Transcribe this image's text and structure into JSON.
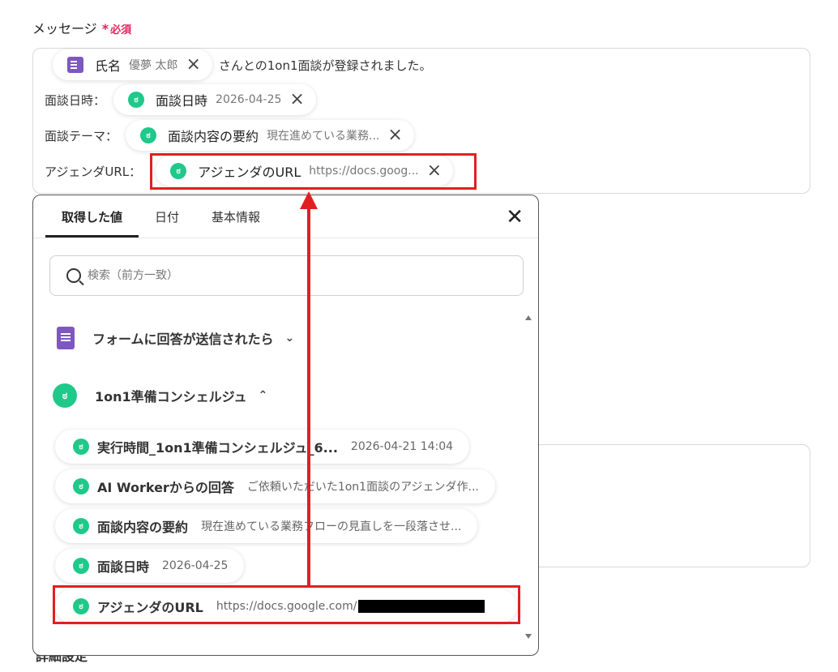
{
  "field": {
    "label": "メッセージ",
    "required": "必須",
    "required_mark": "*"
  },
  "message": {
    "line1": {
      "chip": {
        "name": "氏名",
        "value": "優夢 太郎"
      },
      "suffix": "さんとの1on1面談が登録されました。"
    },
    "line2": {
      "prefix": "面談日時：",
      "chip": {
        "name": "面談日時",
        "value": "2026-04-25"
      }
    },
    "line3": {
      "prefix": "面談テーマ：",
      "chip": {
        "name": "面談内容の要約",
        "value": "現在進めている業務..."
      }
    },
    "line4": {
      "prefix": "アジェンダURL：",
      "chip": {
        "name": "アジェンダのURL",
        "value": "https://docs.goog..."
      }
    },
    "remove_icon": "×"
  },
  "background": {
    "bottom_text": "詳細設定"
  },
  "panel": {
    "tabs": [
      {
        "label": "取得した値",
        "active": true
      },
      {
        "label": "日付"
      },
      {
        "label": "基本情報"
      }
    ],
    "close_icon": "✕",
    "search": {
      "placeholder": "検索（前方一致）"
    },
    "sections": [
      {
        "title": "フォームに回答が送信されたら",
        "chevron": "⌄",
        "icon": "form-icon"
      },
      {
        "title": "1on1準備コンシェルジュ",
        "chevron": "⌃",
        "icon": "concierge-icon"
      }
    ],
    "items": [
      {
        "name": "実行時間_1on1準備コンシェルジュ_6...",
        "value": "2026-04-21 14:04"
      },
      {
        "name": "AI Workerからの回答",
        "value": "ご依頼いただいた1on1面談のアジェンダ作..."
      },
      {
        "name": "面談内容の要約",
        "value": "現在進めている業務フローの見直しを一段落させ..."
      },
      {
        "name": "面談日時",
        "value": "2026-04-25"
      },
      {
        "name": "アジェンダのURL",
        "value": "https://docs.google.com/"
      }
    ]
  },
  "colors": {
    "highlight": "#e02020",
    "accent_green": "#1fc98a",
    "form_purple": "#7e57c2",
    "required_pink": "#e0245e"
  }
}
